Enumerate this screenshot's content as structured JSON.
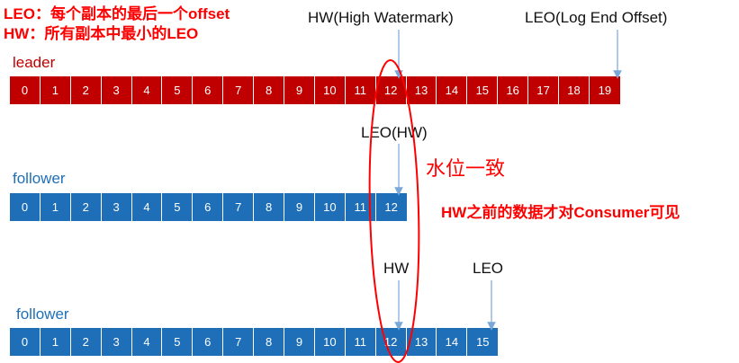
{
  "definitions": {
    "leo": "LEO：每个副本的最后一个offset",
    "hw": "HW：所有副本中最小的LEO"
  },
  "labels": {
    "hw_top": "HW(High Watermark)",
    "leo_top": "LEO(Log End Offset)",
    "leo_hw_mid": "LEO(HW)",
    "hw_bottom": "HW",
    "leo_bottom": "LEO"
  },
  "rows": {
    "leader": {
      "name": "leader",
      "cells": [
        "0",
        "1",
        "2",
        "3",
        "4",
        "5",
        "6",
        "7",
        "8",
        "9",
        "10",
        "11",
        "12",
        "13",
        "14",
        "15",
        "16",
        "17",
        "18",
        "19"
      ]
    },
    "follower1": {
      "name": "follower",
      "cells": [
        "0",
        "1",
        "2",
        "3",
        "4",
        "5",
        "6",
        "7",
        "8",
        "9",
        "10",
        "11",
        "12"
      ]
    },
    "follower2": {
      "name": "follower",
      "cells": [
        "0",
        "1",
        "2",
        "3",
        "4",
        "5",
        "6",
        "7",
        "8",
        "9",
        "10",
        "11",
        "12",
        "13",
        "14",
        "15"
      ]
    }
  },
  "notes": {
    "consistent": "水位一致",
    "visibility": "HW之前的数据才对Consumer可见"
  },
  "colors": {
    "leader": "#c00000",
    "follower": "#1f6fb8",
    "highlight": "#ff0000",
    "arrow": "#7aa7d9"
  }
}
